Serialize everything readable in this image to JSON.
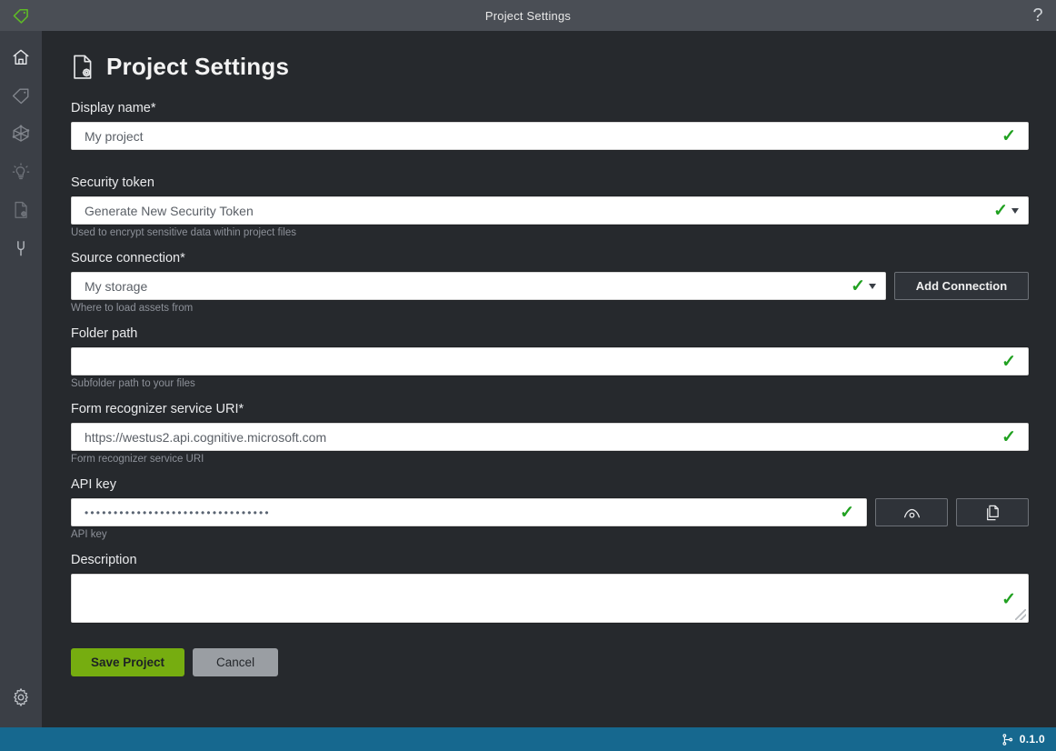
{
  "window": {
    "title": "Project Settings",
    "logo_icon": "tag-icon",
    "help_icon": "question-mark-icon"
  },
  "sidebar": {
    "items": [
      {
        "name": "home",
        "icon": "home-icon",
        "active": true
      },
      {
        "name": "tags",
        "icon": "tag-icon",
        "active": false
      },
      {
        "name": "connections",
        "icon": "graph-nodes-icon",
        "active": false
      },
      {
        "name": "train",
        "icon": "lightbulb-icon",
        "active": false
      },
      {
        "name": "project-settings",
        "icon": "document-gear-icon",
        "active": false
      },
      {
        "name": "application-connection",
        "icon": "plug-icon",
        "active": false
      }
    ],
    "footer": {
      "name": "app-settings",
      "icon": "gear-icon"
    }
  },
  "page": {
    "title": "Project Settings",
    "title_icon": "document-gear-icon"
  },
  "form": {
    "display_name": {
      "label": "Display name*",
      "value": "My project",
      "placeholder": "My project",
      "valid": true
    },
    "security_token": {
      "label": "Security token",
      "value": "Generate New Security Token",
      "hint": "Used to encrypt sensitive data within project files",
      "valid": true,
      "has_dropdown": true
    },
    "source_connection": {
      "label": "Source connection*",
      "value": "My storage",
      "hint": "Where to load assets from",
      "valid": true,
      "has_dropdown": true,
      "add_button": "Add Connection"
    },
    "folder_path": {
      "label": "Folder path",
      "value": "",
      "placeholder": "",
      "hint": "Subfolder path to your files",
      "valid": true
    },
    "service_uri": {
      "label": "Form recognizer service URI*",
      "value": "https://westus2.api.cognitive.microsoft.com",
      "hint": "Form recognizer service URI",
      "valid": true
    },
    "api_key": {
      "label": "API key",
      "value": "••••••••••••••••••••••••••••••••",
      "hint": "API key",
      "valid": true,
      "reveal_icon": "eye-icon",
      "copy_icon": "copy-icon"
    },
    "description": {
      "label": "Description",
      "value": "",
      "valid": true
    }
  },
  "actions": {
    "save_label": "Save Project",
    "cancel_label": "Cancel",
    "save_color": "#76ad10",
    "cancel_color": "#9a9ea3"
  },
  "statusbar": {
    "version": "0.1.0",
    "branch_icon": "git-branch-icon",
    "background": "#16688f"
  }
}
